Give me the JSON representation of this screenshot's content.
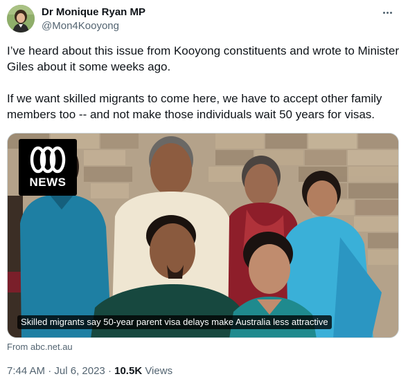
{
  "author": {
    "display_name": "Dr Monique Ryan MP",
    "handle": "@Mon4Kooyong"
  },
  "more_icon": "more-horizontal-icon",
  "tweet": {
    "paragraph_1": "I’ve heard about this issue from Kooyong constituents and wrote to Minister Giles about it some weeks ago.",
    "paragraph_2": "If we want skilled migrants to come here, we have to accept other family members too -- and not make those individuals wait 50 years for visas."
  },
  "media": {
    "logo_text": "NEWS",
    "caption": "Skilled migrants say 50-year parent visa delays make Australia less attractive"
  },
  "link_source": "From abc.net.au",
  "meta": {
    "time": "7:44 AM",
    "separator_1": "·",
    "date": "Jul 6, 2023",
    "separator_2": "·",
    "views_count": "10.5K",
    "views_label": "Views"
  },
  "colors": {
    "text_primary": "#0f1419",
    "text_secondary": "#536471",
    "border": "#cfd9de"
  }
}
